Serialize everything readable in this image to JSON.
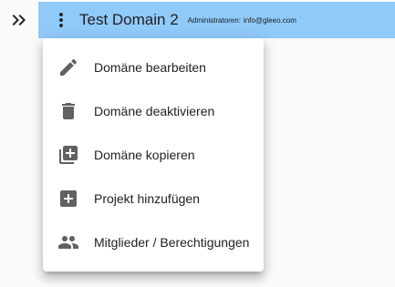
{
  "header": {
    "title": "Test Domain 2",
    "admin_label": "Administratoren:",
    "admin_email": "info@gleeo.com",
    "bar_color": "#90caf9",
    "expand_icon": "double-chevron-right-icon",
    "menu_icon": "more-vertical-icon"
  },
  "menu": {
    "items": [
      {
        "label": "Domäne bearbeiten",
        "icon": "pencil-icon"
      },
      {
        "label": "Domäne deaktivieren",
        "icon": "trash-icon"
      },
      {
        "label": "Domäne kopieren",
        "icon": "library-add-icon"
      },
      {
        "label": "Projekt hinzufügen",
        "icon": "add-box-icon"
      },
      {
        "label": "Mitglieder / Berechtigungen",
        "icon": "people-icon"
      }
    ]
  }
}
